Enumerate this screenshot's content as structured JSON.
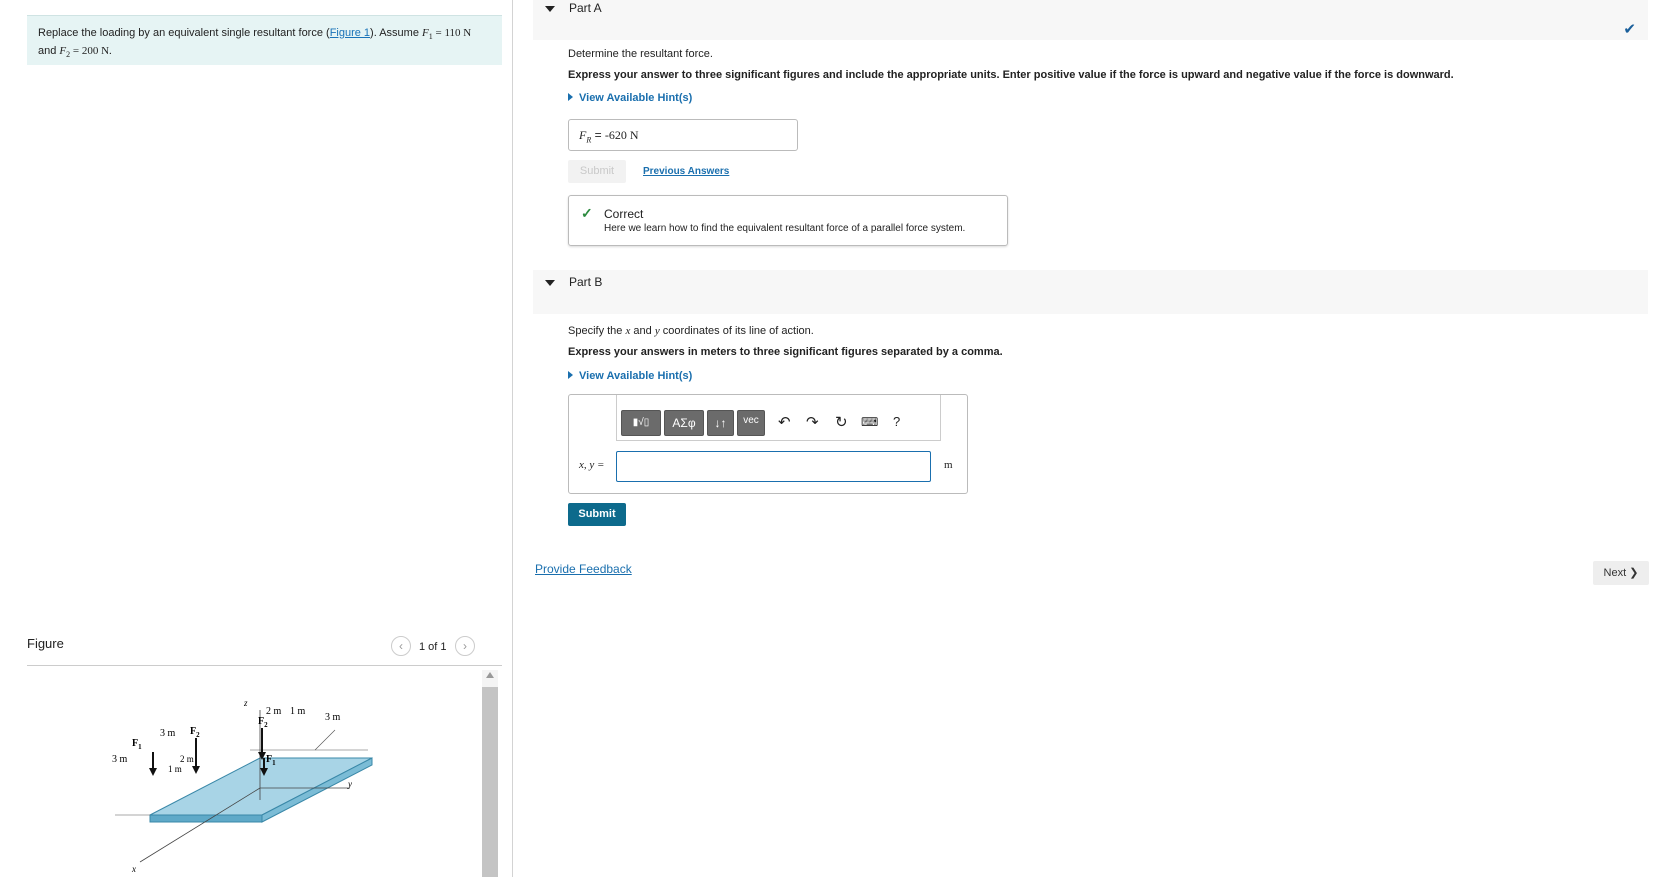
{
  "problem": {
    "text_before_link": "Replace the loading by an equivalent single resultant force (",
    "link": "Figure 1",
    "text_after_link": "). Assume ",
    "f1_sym": "F",
    "f1_sub": "1",
    "f1_value": " = 110 N",
    "line2_and": "and ",
    "f2_sym": "F",
    "f2_sub": "2",
    "f2_value": " = 200 N."
  },
  "figure_panel": {
    "title": "Figure",
    "pager": "1 of 1",
    "prev_icon": "chevron-left-icon",
    "next_icon": "chevron-right-icon"
  },
  "figure_labels": {
    "z": "z",
    "y": "y",
    "x": "x",
    "F1_top": "F",
    "F1_top_sub": "1",
    "F2_top": "F",
    "F2_top_sub": "2",
    "F2_left": "F",
    "F2_left_sub": "2",
    "F1_left": "F",
    "F1_left_sub": "1",
    "dim_2m_top": "2 m",
    "dim_1m_top": "1 m",
    "dim_3m_top": "3 m",
    "dim_3m_left": "3 m",
    "dim_3m_side": "3 m",
    "dim_2m_left": "2 m",
    "dim_1m_left": "1 m"
  },
  "partA": {
    "label": "Part A",
    "completed_icon": "checkmark-icon",
    "prompt": "Determine the resultant force.",
    "instructions": "Express your answer to three significant figures and include the appropriate units. Enter positive value if the force is upward and negative value if the force is downward.",
    "hint": "View Available Hint(s)",
    "answer_var": "F",
    "answer_sub": "R",
    "answer_eq": " = ",
    "answer_value": "-620 N",
    "submit": "Submit",
    "previous_answers": "Previous Answers",
    "feedback_title": "Correct",
    "feedback_body": "Here we learn how to find the equivalent resultant force of a parallel force system."
  },
  "partB": {
    "label": "Part B",
    "prompt_before": "Specify the ",
    "prompt_x": "x",
    "prompt_and": " and ",
    "prompt_y": "y",
    "prompt_after": " coordinates of its line of action.",
    "instructions": "Express your answers in meters to three significant figures separated by a comma.",
    "hint": "View Available Hint(s)",
    "input_label": "x, y =",
    "input_value": "",
    "unit": "m",
    "submit": "Submit",
    "toolbar": {
      "templates": "▮√▯",
      "greek": "ΑΣφ",
      "arrows": "↓↑",
      "vec": "vec",
      "undo_icon": "undo-icon",
      "redo_icon": "redo-icon",
      "reset_icon": "reset-icon",
      "keyboard_icon": "keyboard-icon",
      "help": "?"
    }
  },
  "footer": {
    "provide_feedback": "Provide Feedback",
    "next": "Next"
  }
}
